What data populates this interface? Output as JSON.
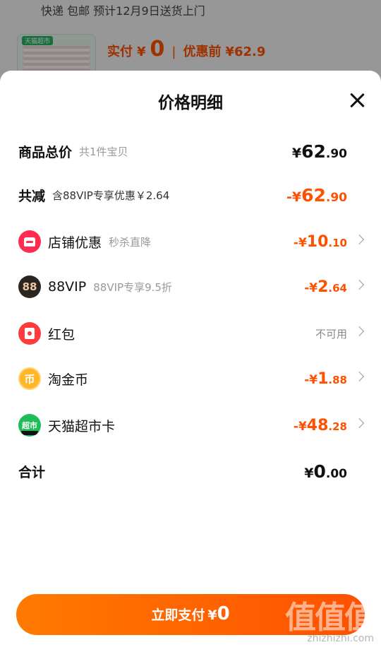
{
  "background": {
    "shipping_prefix": "快递 包邮  预计12月9日送货上门",
    "shipping_link": "送货上门",
    "thumb_tag": "天猫超市",
    "paid_label": "实付",
    "paid_currency": "¥",
    "paid_amount": "0",
    "orig_label": "优惠前",
    "orig_amount": "¥62.9"
  },
  "sheet": {
    "title": "价格明细",
    "rows": [
      {
        "label": "商品总价",
        "sub": "共1件宝贝",
        "cur": "¥",
        "int": "62",
        "dec": ".90"
      },
      {
        "label": "共减",
        "sub": "含88VIP专享优惠￥2.64",
        "cur": "-¥",
        "int": "62",
        "dec": ".90"
      },
      {
        "icon": "shop-icon",
        "label": "店铺优惠",
        "sub": "秒杀直降",
        "cur": "-¥",
        "int": "10",
        "dec": ".10"
      },
      {
        "icon": "vip-icon",
        "icon_text": "88",
        "label": "88VIP",
        "sub": "88VIP专享9.5折",
        "cur": "-¥",
        "int": "2",
        "dec": ".64"
      },
      {
        "icon": "red-envelope-icon",
        "label": "红包",
        "value_text": "不可用"
      },
      {
        "icon": "coin-icon",
        "icon_text": "币",
        "label": "淘金币",
        "cur": "-¥",
        "int": "1",
        "dec": ".88"
      },
      {
        "icon": "supermarket-card-icon",
        "icon_text": "超市",
        "label": "天猫超市卡",
        "cur": "-¥",
        "int": "48",
        "dec": ".28"
      },
      {
        "label": "合计",
        "cur": "¥",
        "int": "0",
        "dec": ".00"
      }
    ]
  },
  "pay_button": {
    "label": "立即支付",
    "cur": "¥",
    "amount": "0"
  },
  "watermark": {
    "logo": "值值值",
    "site": "zhizhizhi.com"
  },
  "colors": {
    "accent": "#ff5000",
    "green": "#2aa84a"
  }
}
